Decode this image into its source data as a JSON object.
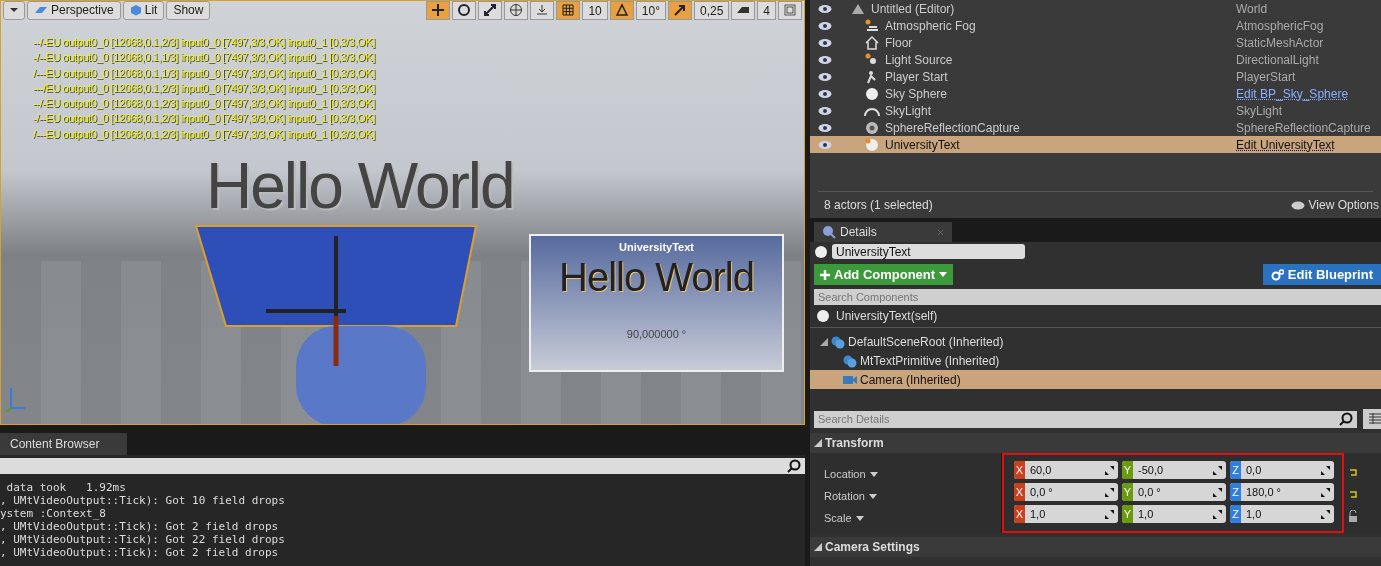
{
  "viewport": {
    "toolbar_left": [
      {
        "kind": "caret"
      },
      {
        "kind": "perspective",
        "label": "Perspective"
      },
      {
        "kind": "lit",
        "label": "Lit"
      },
      {
        "kind": "show",
        "label": "Show"
      }
    ],
    "toolbar_right": [
      {
        "kind": "translate",
        "on": true
      },
      {
        "kind": "rotate",
        "on": false
      },
      {
        "kind": "scale",
        "on": false
      },
      {
        "kind": "globe",
        "on": false
      },
      {
        "kind": "surface",
        "on": false
      },
      {
        "kind": "grid",
        "on": true,
        "value": "10"
      },
      {
        "kind": "angle",
        "on": true,
        "value": "10°"
      },
      {
        "kind": "scale_snap",
        "on": true,
        "value": "0,25"
      },
      {
        "kind": "speed",
        "on": false,
        "value": "4"
      },
      {
        "kind": "maximize",
        "on": false
      }
    ],
    "overlay_lines": [
      "--/-EU output0_0 [12068,0.1,2/3] input0_0 [7497,3/3,OK] input0_1 [0,3/3,OK]",
      "-/--EU output0_0 [12068,0.1,1/3] input0_0 [7497,3/3,OK] input0_1 [0,3/3,OK]",
      "/---EU output0_0 [12068,0.1,1/3] input0_0 [7497,3/3,OK] input0_1 [0,3/3,OK]",
      "---/EU output0_0 [12068,0.1,2/3] input0_0 [7497,3/3,OK] input0_1 [0,3/3,OK]",
      "--/-EU output0_0 [12068,0.1,2/3] input0_0 [7497,3/3,OK] input0_1 [0,3/3,OK]",
      "-/--EU output0_0 [12068,0.1,2/3] input0_0 [7497,3/3,OK] input0_1 [0,3/3,OK]",
      "/---EU output0_0 [12068,0.1,2/3] input0_0 [7497,3/3,OK] input0_1 [0,3/3,OK]"
    ],
    "scene_text": "Hello World",
    "preview": {
      "title": "UniversityText",
      "text": "Hello World",
      "reading": "90,000000 °"
    }
  },
  "content_browser": {
    "tab": "Content Browser",
    "log_lines": [
      " data took   1.92ms",
      ", UMtVideoOutput::Tick): Got 10 field drops",
      "ystem :Context_8",
      ", UMtVideoOutput::Tick): Got 2 field drops",
      ", UMtVideoOutput::Tick): Got 22 field drops",
      ", UMtVideoOutput::Tick): Got 2 field drops"
    ]
  },
  "outliner": {
    "rows": [
      {
        "kind": "world",
        "name": "Untitled (Editor)",
        "type": "World",
        "type_link": false,
        "selected": false
      },
      {
        "kind": "fog",
        "name": "Atmospheric Fog",
        "type": "AtmosphericFog",
        "type_link": false,
        "selected": false
      },
      {
        "kind": "mesh",
        "name": "Floor",
        "type": "StaticMeshActor",
        "type_link": false,
        "selected": false
      },
      {
        "kind": "light",
        "name": "Light Source",
        "type": "DirectionalLight",
        "type_link": false,
        "selected": false
      },
      {
        "kind": "player",
        "name": "Player Start",
        "type": "PlayerStart",
        "type_link": false,
        "selected": false
      },
      {
        "kind": "sphere",
        "name": "Sky Sphere",
        "type": "Edit BP_Sky_Sphere",
        "type_link": true,
        "selected": false
      },
      {
        "kind": "skylight",
        "name": "SkyLight",
        "type": "SkyLight",
        "type_link": false,
        "selected": false
      },
      {
        "kind": "capture",
        "name": "SphereReflectionCapture",
        "type": "SphereReflectionCapture",
        "type_link": false,
        "selected": false
      },
      {
        "kind": "sphere",
        "name": "UniversityText",
        "type": "Edit UniversityText",
        "type_link": true,
        "selected": true
      }
    ],
    "footer": "8 actors (1 selected)",
    "view_options": "View Options"
  },
  "details": {
    "tab": "Details",
    "name_value": "UniversityText",
    "add_component": "Add Component",
    "edit_blueprint": "Edit Blueprint",
    "search_components": {
      "placeholder": "Search Components"
    },
    "self": "UniversityText(self)",
    "components": [
      {
        "name": "DefaultSceneRoot (Inherited)",
        "kind": "scene",
        "selected": false,
        "expanded": true,
        "children": [
          {
            "name": "MtTextPrimitive (Inherited)",
            "kind": "scene",
            "selected": false
          },
          {
            "name": "Camera (Inherited)",
            "kind": "camera",
            "selected": true
          }
        ]
      }
    ],
    "search_details": {
      "placeholder": "Search Details"
    },
    "transform": {
      "title": "Transform",
      "rows": [
        {
          "label": "Location",
          "kind": "reset",
          "values": [
            {
              "axis": "X",
              "value": "60,0"
            },
            {
              "axis": "Y",
              "value": "-50,0"
            },
            {
              "axis": "Z",
              "value": "0,0"
            }
          ]
        },
        {
          "label": "Rotation",
          "kind": "reset",
          "values": [
            {
              "axis": "X",
              "value": "0,0 °"
            },
            {
              "axis": "Y",
              "value": "0,0 °"
            },
            {
              "axis": "Z",
              "value": "180,0 °"
            }
          ]
        },
        {
          "label": "Scale",
          "kind": "lock",
          "values": [
            {
              "axis": "X",
              "value": "1,0"
            },
            {
              "axis": "Y",
              "value": "1,0"
            },
            {
              "axis": "Z",
              "value": "1,0"
            }
          ]
        }
      ]
    },
    "camera_settings": "Camera Settings"
  }
}
